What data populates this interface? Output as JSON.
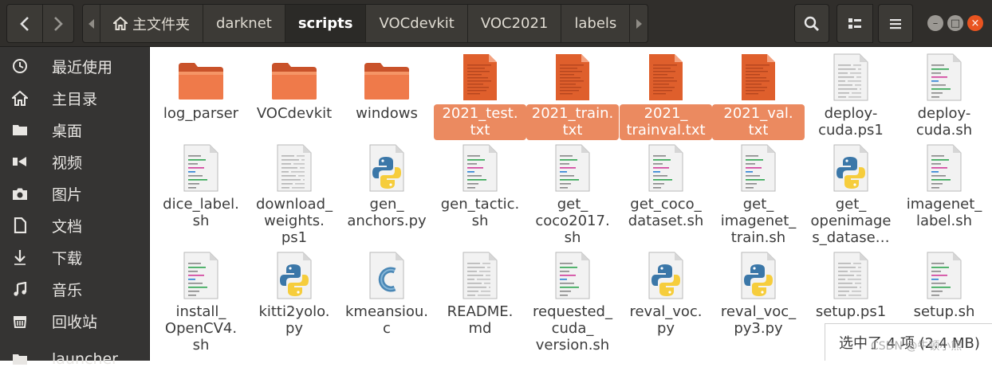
{
  "header": {
    "back_icon": "chevron-left-icon",
    "forward_icon": "chevron-right-icon",
    "breadcrumbs": [
      "主文件夹",
      "darknet",
      "scripts",
      "VOCdevkit",
      "VOC2021",
      "labels"
    ],
    "active_crumb": "scripts",
    "search_icon": "search-icon",
    "view_icon": "view-toggle-icon",
    "menu_icon": "hamburger-menu-icon",
    "window_buttons": {
      "minimize": "–",
      "maximize": "□",
      "close": "×"
    }
  },
  "sidebar": {
    "items": [
      {
        "label": "最近使用",
        "icon": "clock-icon"
      },
      {
        "label": "主目录",
        "icon": "home-icon"
      },
      {
        "label": "桌面",
        "icon": "folder-icon"
      },
      {
        "label": "视频",
        "icon": "video-icon"
      },
      {
        "label": "图片",
        "icon": "camera-icon"
      },
      {
        "label": "文档",
        "icon": "document-icon"
      },
      {
        "label": "下载",
        "icon": "download-icon"
      },
      {
        "label": "音乐",
        "icon": "music-icon"
      },
      {
        "label": "回收站",
        "icon": "trash-icon"
      },
      {
        "label": "launcher",
        "icon": "launcher-icon"
      }
    ]
  },
  "files": [
    {
      "name": "log_parser",
      "type": "folder",
      "selected": false
    },
    {
      "name": "VOCdevkit",
      "type": "folder",
      "selected": false
    },
    {
      "name": "windows",
      "type": "folder",
      "selected": false
    },
    {
      "name": "2021_test.\ntxt",
      "type": "text-selected",
      "selected": true
    },
    {
      "name": "2021_train.\ntxt",
      "type": "text-selected",
      "selected": true
    },
    {
      "name": "2021_\ntrainval.txt",
      "type": "text-selected",
      "selected": true
    },
    {
      "name": "2021_val.\ntxt",
      "type": "text-selected",
      "selected": true
    },
    {
      "name": "deploy-\ncuda.ps1",
      "type": "text",
      "selected": false
    },
    {
      "name": "deploy-\ncuda.sh",
      "type": "script",
      "selected": false
    },
    {
      "name": "dice_label.\nsh",
      "type": "script",
      "selected": false
    },
    {
      "name": "download_\nweights.\nps1",
      "type": "text",
      "selected": false
    },
    {
      "name": "gen_\nanchors.py",
      "type": "python",
      "selected": false
    },
    {
      "name": "gen_tactic.\nsh",
      "type": "script",
      "selected": false
    },
    {
      "name": "get_\ncoco2017.\nsh",
      "type": "script",
      "selected": false
    },
    {
      "name": "get_coco_\ndataset.sh",
      "type": "script",
      "selected": false
    },
    {
      "name": "get_\nimagenet_\ntrain.sh",
      "type": "script",
      "selected": false
    },
    {
      "name": "get_\nopenimage\ns_datase…",
      "type": "python",
      "selected": false
    },
    {
      "name": "imagenet_\nlabel.sh",
      "type": "script",
      "selected": false
    },
    {
      "name": "install_\nOpenCV4.\nsh",
      "type": "script",
      "selected": false
    },
    {
      "name": "kitti2yolo.\npy",
      "type": "python",
      "selected": false
    },
    {
      "name": "kmeansiou.\nc",
      "type": "c",
      "selected": false
    },
    {
      "name": "README.\nmd",
      "type": "text",
      "selected": false
    },
    {
      "name": "requested_\ncuda_\nversion.sh",
      "type": "script",
      "selected": false
    },
    {
      "name": "reval_voc.\npy",
      "type": "python",
      "selected": false
    },
    {
      "name": "reval_voc_\npy3.py",
      "type": "python",
      "selected": false
    },
    {
      "name": "setup.ps1",
      "type": "text",
      "selected": false
    },
    {
      "name": "setup.sh",
      "type": "script",
      "selected": false
    }
  ],
  "status": {
    "text": "选中了 4 项 (2.4 MB)"
  },
  "watermark": "CSDN @牛顿小熊",
  "colors": {
    "accent": "#eb8a60",
    "folder": "#e9663a",
    "header": "#302e2b",
    "sidebar": "#353433"
  }
}
